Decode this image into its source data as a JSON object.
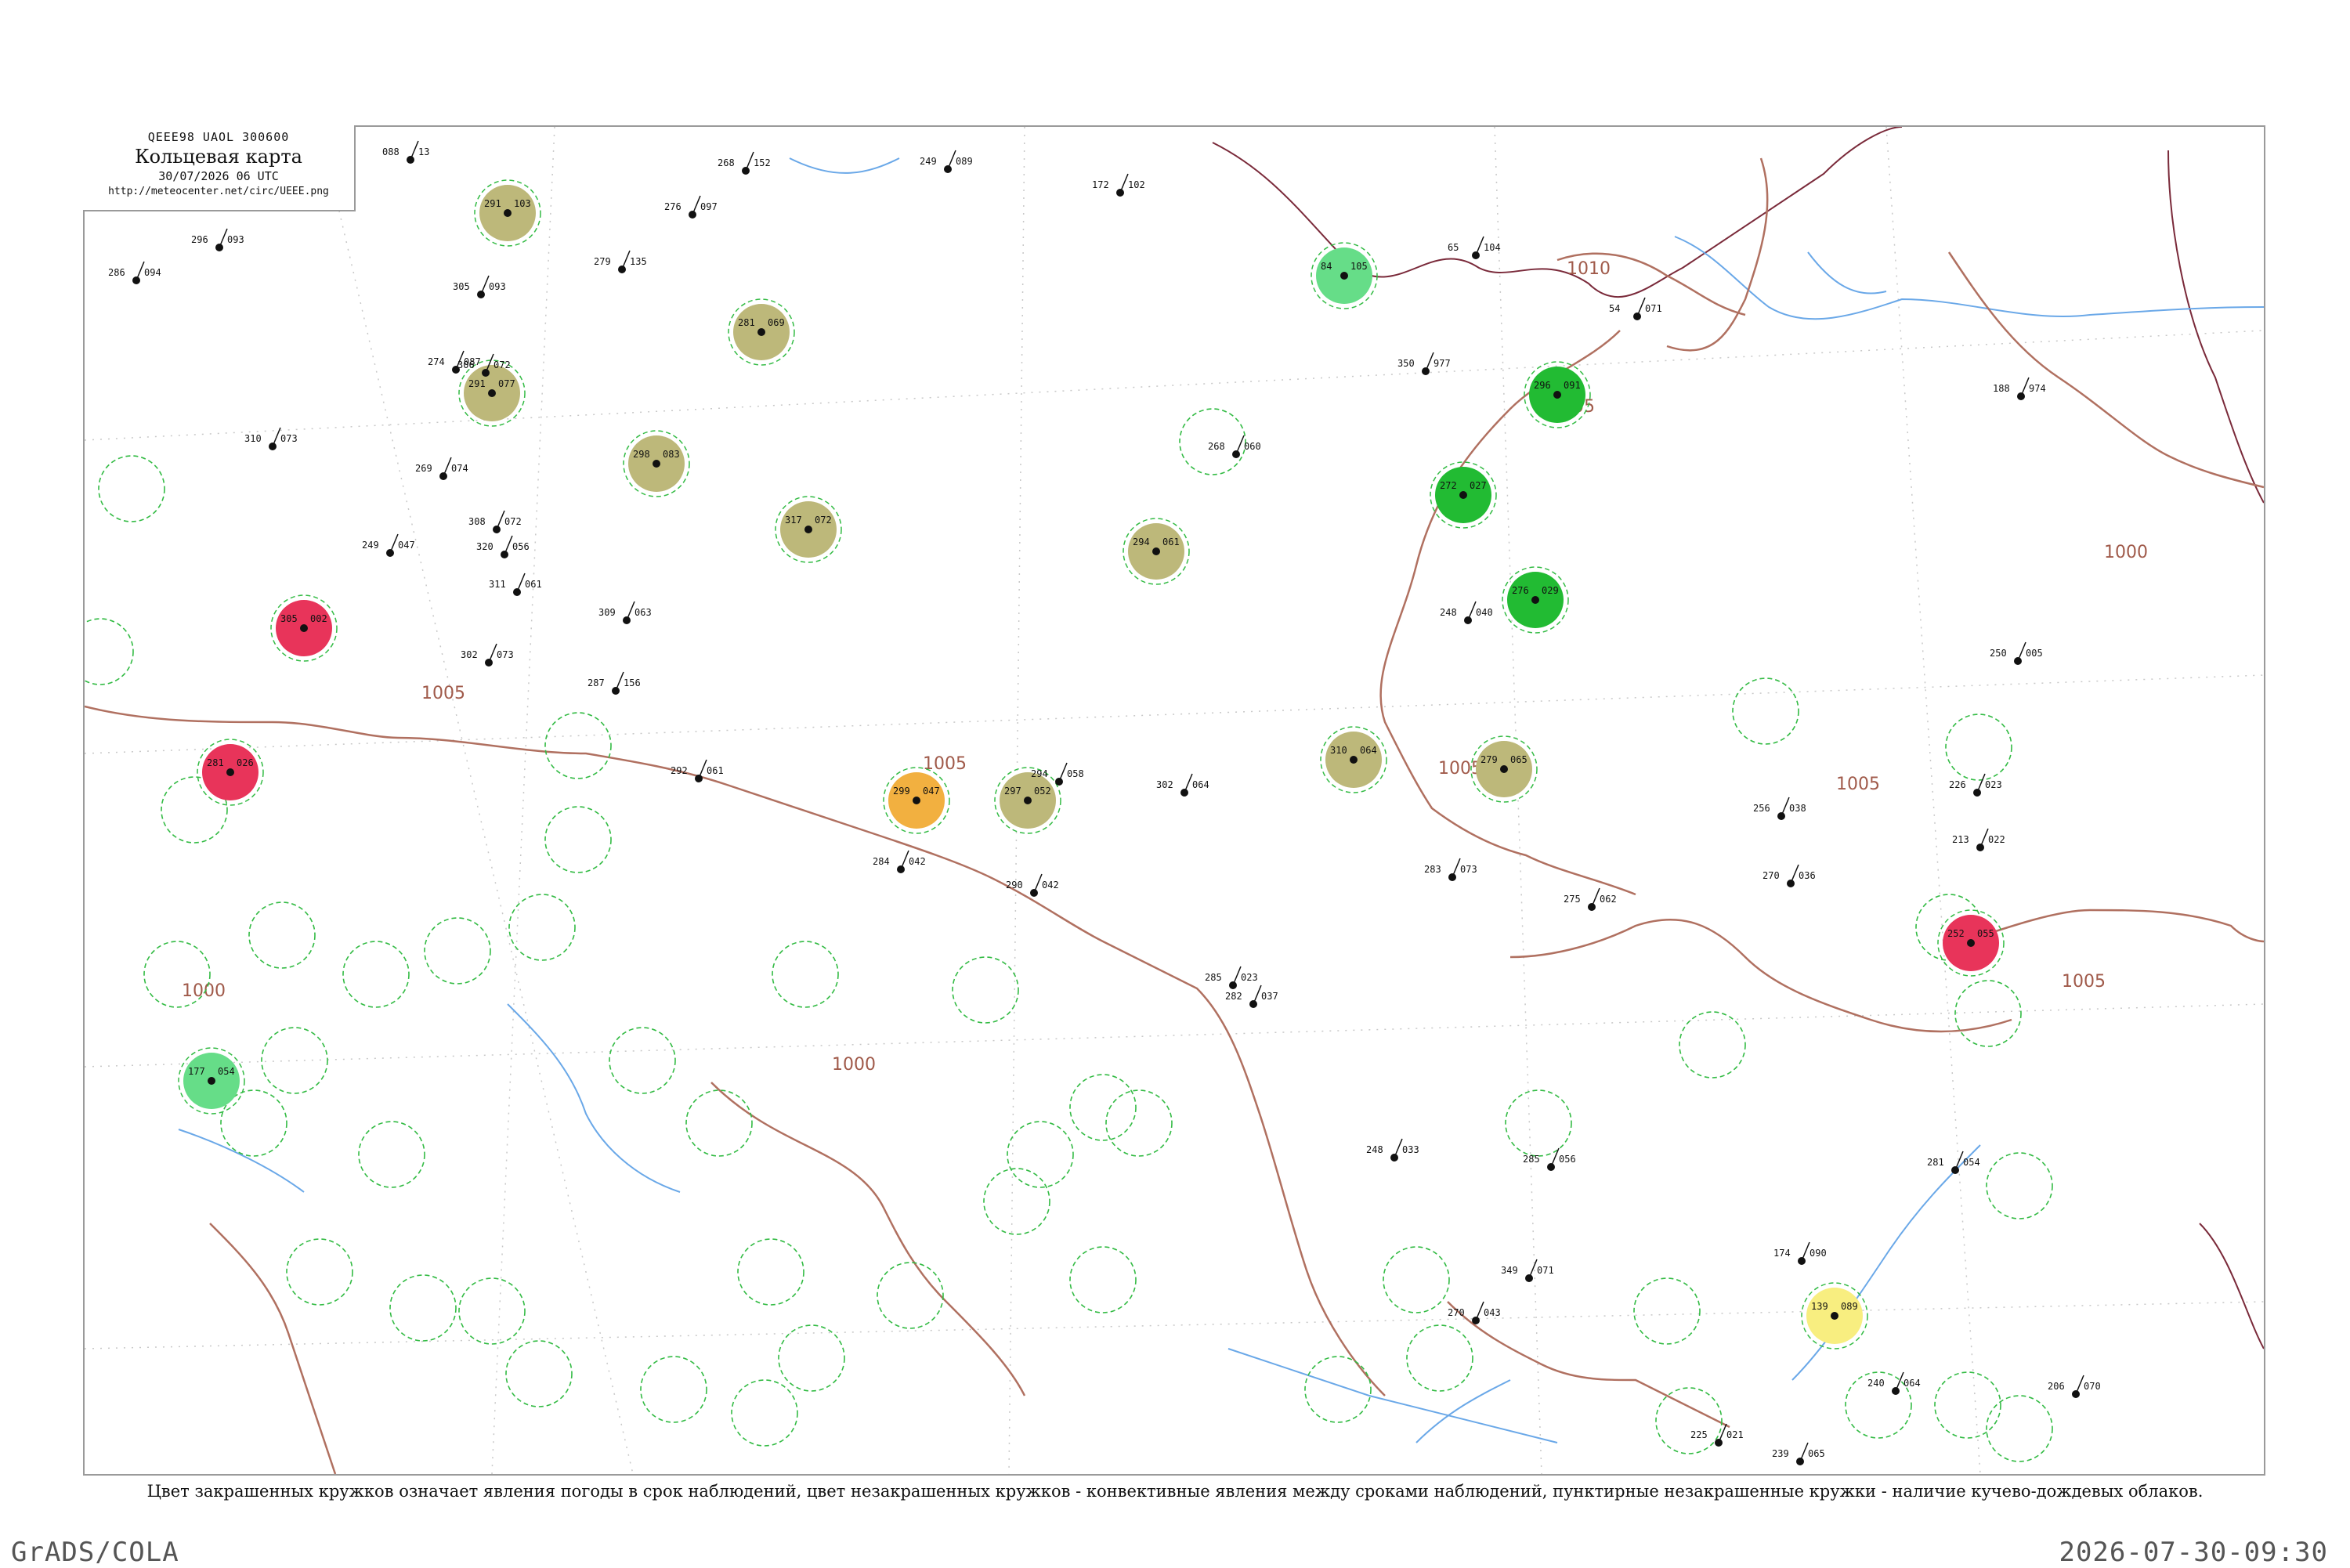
{
  "header": {
    "code": "QEEE98  UAOL  300600",
    "title": "Кольцевая карта",
    "date": "30/07/2026 06 UTC",
    "url": "http://meteocenter.net/circ/UEEE.png"
  },
  "caption": "Цвет закрашенных кружков означает явления погоды в срок наблюдений, цвет незакрашенных кружков - конвективные явления между сроками наблюдений, пунктирные незакрашенные кружки - наличие кучево-дождевых облаков.",
  "footer": {
    "left": "GrADS/COLA",
    "right": "2026-07-30-09:30"
  },
  "colors": {
    "rain_green": "#22bb33",
    "showers_light_green": "#66dd88",
    "thunder_red": "#e8345a",
    "olive_haze": "#bdb87a",
    "orange_fog": "#f2b040",
    "yellow": "#f8ee80",
    "isobar": "#b07060",
    "river": "#6aa8e8"
  },
  "isobars": [
    {
      "label": "1010"
    },
    {
      "label": "1005"
    },
    {
      "label": "1005"
    },
    {
      "label": "1005"
    },
    {
      "label": "1005"
    },
    {
      "label": "1005"
    },
    {
      "label": "1005"
    },
    {
      "label": "1000"
    },
    {
      "label": "1000"
    },
    {
      "label": "1000"
    }
  ],
  "stations": [
    {
      "t": "291",
      "p": "103",
      "wx": "olive"
    },
    {
      "t": "298",
      "p": "083",
      "wx": "olive"
    },
    {
      "t": "291",
      "p": "077",
      "wx": "olive"
    },
    {
      "t": "281",
      "p": "069",
      "wx": "olive"
    },
    {
      "t": "317",
      "p": "072",
      "wx": "olive"
    },
    {
      "t": "294",
      "p": "061",
      "wx": "olive"
    },
    {
      "t": "297",
      "p": "052",
      "wx": "olive"
    },
    {
      "t": "310",
      "p": "064",
      "wx": "olive"
    },
    {
      "t": "279",
      "p": "065",
      "wx": "olive"
    },
    {
      "t": "299",
      "p": "047",
      "wx": "orange"
    },
    {
      "t": "84",
      "p": "105",
      "wx": "light"
    },
    {
      "t": "177",
      "p": "054",
      "wx": "light"
    },
    {
      "t": "139",
      "p": "089",
      "wx": "yellow"
    },
    {
      "t": "296",
      "p": "091",
      "wx": "green"
    },
    {
      "t": "272",
      "p": "027",
      "wx": "green"
    },
    {
      "t": "276",
      "p": "029",
      "wx": "green"
    },
    {
      "t": "305",
      "p": "002",
      "wx": "red"
    },
    {
      "t": "281",
      "p": "026",
      "wx": "red"
    },
    {
      "t": "252",
      "p": "055",
      "wx": "red"
    }
  ],
  "plain_stations": [
    {
      "t": "088",
      "p": "13"
    },
    {
      "t": "268",
      "p": "152"
    },
    {
      "t": "249",
      "p": "089"
    },
    {
      "t": "172",
      "p": "102"
    },
    {
      "t": "276",
      "p": "097"
    },
    {
      "t": "296",
      "p": "093"
    },
    {
      "t": "286",
      "p": "094"
    },
    {
      "t": "305",
      "p": "093"
    },
    {
      "t": "279",
      "p": "135"
    },
    {
      "t": "65",
      "p": "104"
    },
    {
      "t": "54",
      "p": "071"
    },
    {
      "t": "350",
      "p": "977"
    },
    {
      "t": "274",
      "p": "087"
    },
    {
      "t": "306",
      "p": "072"
    },
    {
      "t": "188",
      "p": "974"
    },
    {
      "t": "310",
      "p": "073"
    },
    {
      "t": "269",
      "p": "074"
    },
    {
      "t": "268",
      "p": "060"
    },
    {
      "t": "320",
      "p": "056"
    },
    {
      "t": "308",
      "p": "072"
    },
    {
      "t": "249",
      "p": "047"
    },
    {
      "t": "311",
      "p": "061"
    },
    {
      "t": "309",
      "p": "063"
    },
    {
      "t": "302",
      "p": "073"
    },
    {
      "t": "248",
      "p": "040"
    },
    {
      "t": "250",
      "p": "005"
    },
    {
      "t": "287",
      "p": "156"
    },
    {
      "t": "292",
      "p": "061"
    },
    {
      "t": "294",
      "p": "058"
    },
    {
      "t": "302",
      "p": "064"
    },
    {
      "t": "256",
      "p": "038"
    },
    {
      "t": "226",
      "p": "023"
    },
    {
      "t": "283",
      "p": "073"
    },
    {
      "t": "290",
      "p": "042"
    },
    {
      "t": "284",
      "p": "042"
    },
    {
      "t": "270",
      "p": "036"
    },
    {
      "t": "213",
      "p": "022"
    },
    {
      "t": "275",
      "p": "062"
    },
    {
      "t": "285",
      "p": "023"
    },
    {
      "t": "282",
      "p": "037"
    },
    {
      "t": "248",
      "p": "033"
    },
    {
      "t": "285",
      "p": "056"
    },
    {
      "t": "281",
      "p": "054"
    },
    {
      "t": "174",
      "p": "090"
    },
    {
      "t": "349",
      "p": "071"
    },
    {
      "t": "270",
      "p": "043"
    },
    {
      "t": "206",
      "p": "070"
    },
    {
      "t": "240",
      "p": "064"
    },
    {
      "t": "225",
      "p": "021"
    },
    {
      "t": "239",
      "p": "065"
    }
  ]
}
